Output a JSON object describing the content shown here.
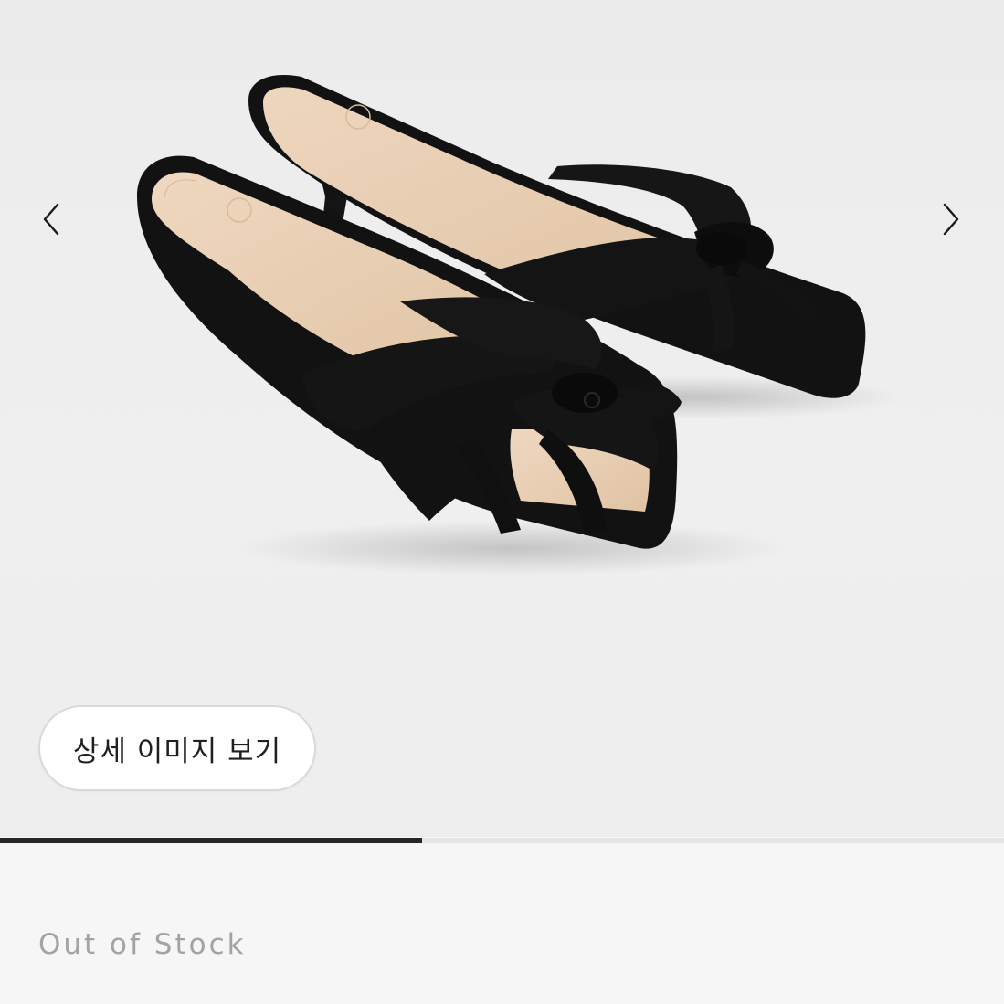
{
  "gallery": {
    "prev_icon": "chevron-left-icon",
    "next_icon": "chevron-right-icon",
    "image_subject": "black-suede-kitten-heel-mule-sandals"
  },
  "detail_button": {
    "label": "상세 이미지 보기"
  },
  "carousel_progress": {
    "fraction": 0.42,
    "fill_color": "#262626",
    "track_color": "#e6e6e6"
  },
  "product": {
    "stock_status": "Out of Stock"
  },
  "colors": {
    "background": "#f6f6f6",
    "sandal": "#121212",
    "insole": "#e8cfb5",
    "status_text": "#a3a3a3"
  }
}
